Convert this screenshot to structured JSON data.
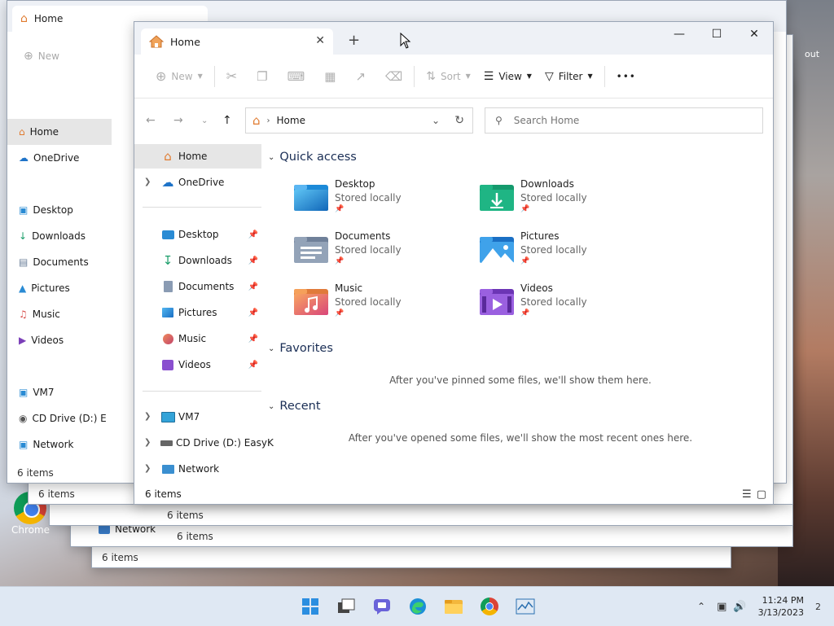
{
  "window": {
    "tab_title": "Home",
    "new_tab": "+",
    "status": "6 items"
  },
  "toolbar": {
    "new_label": "New",
    "sort_label": "Sort",
    "view_label": "View",
    "filter_label": "Filter",
    "more_label": "•••"
  },
  "address": {
    "path": "Home",
    "search_placeholder": "Search Home"
  },
  "nav": {
    "home": "Home",
    "onedrive": "OneDrive",
    "desktop": "Desktop",
    "downloads": "Downloads",
    "documents": "Documents",
    "pictures": "Pictures",
    "music": "Music",
    "videos": "Videos",
    "vm7": "VM7",
    "cddrive": "CD Drive (D:) EasyK",
    "network": "Network"
  },
  "bgnav": {
    "cddrive": "CD Drive (D:) E"
  },
  "sections": {
    "quick_access": "Quick access",
    "favorites": "Favorites",
    "recent": "Recent",
    "favorites_empty": "After you've pinned some files, we'll show them here.",
    "recent_empty": "After you've opened some files, we'll show the most recent ones here."
  },
  "quick_access": [
    {
      "name": "Desktop",
      "sub": "Stored locally"
    },
    {
      "name": "Downloads",
      "sub": "Stored locally"
    },
    {
      "name": "Documents",
      "sub": "Stored locally"
    },
    {
      "name": "Pictures",
      "sub": "Stored locally"
    },
    {
      "name": "Music",
      "sub": "Stored locally"
    },
    {
      "name": "Videos",
      "sub": "Stored locally"
    }
  ],
  "desktop": {
    "chrome_label": "Chrome",
    "network_label": "Network",
    "out_label": "out"
  },
  "clock": {
    "time": "11:24 PM",
    "date": "3/13/2023",
    "notif": "2"
  }
}
